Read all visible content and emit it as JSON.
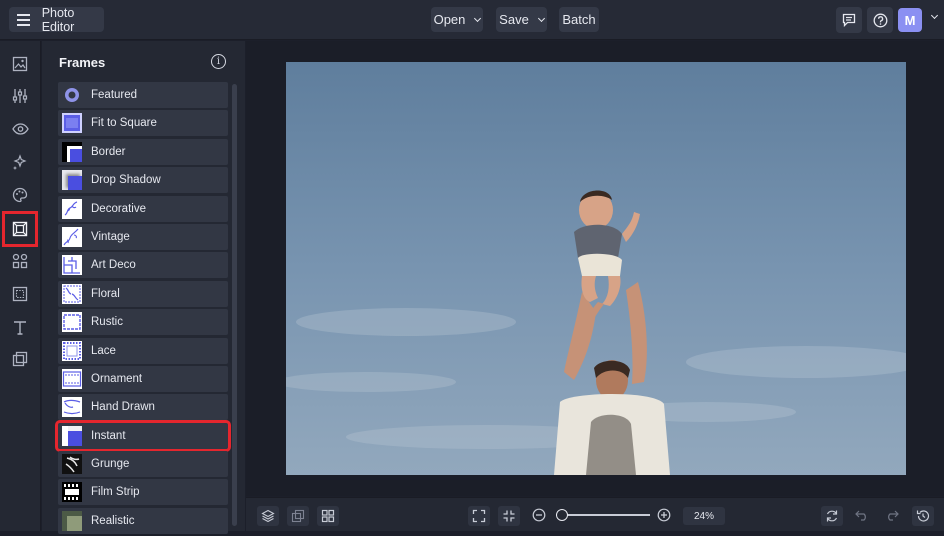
{
  "app": {
    "title": "Photo Editor",
    "avatar_initial": "M"
  },
  "topbar": {
    "open_label": "Open",
    "save_label": "Save",
    "batch_label": "Batch"
  },
  "panel": {
    "title": "Frames",
    "items": [
      {
        "label": "Featured",
        "icon": "badge-icon"
      },
      {
        "label": "Fit to Square",
        "icon": "frame-thumb"
      },
      {
        "label": "Border",
        "icon": "frame-thumb"
      },
      {
        "label": "Drop Shadow",
        "icon": "frame-thumb"
      },
      {
        "label": "Decorative",
        "icon": "frame-thumb"
      },
      {
        "label": "Vintage",
        "icon": "frame-thumb"
      },
      {
        "label": "Art Deco",
        "icon": "frame-thumb"
      },
      {
        "label": "Floral",
        "icon": "frame-thumb"
      },
      {
        "label": "Rustic",
        "icon": "frame-thumb"
      },
      {
        "label": "Lace",
        "icon": "frame-thumb"
      },
      {
        "label": "Ornament",
        "icon": "frame-thumb"
      },
      {
        "label": "Hand Drawn",
        "icon": "frame-thumb"
      },
      {
        "label": "Instant",
        "icon": "frame-thumb",
        "selected": true
      },
      {
        "label": "Grunge",
        "icon": "frame-thumb"
      },
      {
        "label": "Film Strip",
        "icon": "frame-thumb"
      },
      {
        "label": "Realistic",
        "icon": "frame-thumb"
      }
    ]
  },
  "zoom": {
    "value": "24%"
  },
  "colors": {
    "accent": "#5b5ee6",
    "highlight": "#e5262e",
    "background": "#1c1f2a"
  }
}
